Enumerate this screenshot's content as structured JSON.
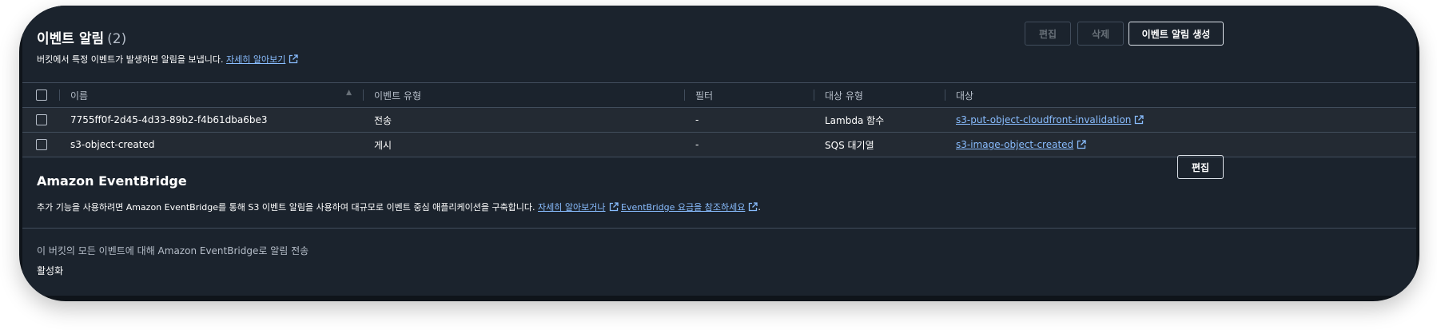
{
  "event_notifications": {
    "title": "이벤트 알림",
    "count": "(2)",
    "description": "버킷에서 특정 이벤트가 발생하면 알림을 보냅니다.",
    "learn_more": "자세히 알아보기",
    "buttons": {
      "edit": "편집",
      "delete": "삭제",
      "create": "이벤트 알림 생성"
    },
    "columns": {
      "name": "이름",
      "event_type": "이벤트 유형",
      "filter": "필터",
      "destination_type": "대상 유형",
      "destination": "대상"
    },
    "rows": [
      {
        "name": "7755ff0f-2d45-4d33-89b2-f4b61dba6be3",
        "event_type": "전송",
        "filter": "-",
        "destination_type": "Lambda 함수",
        "destination": "s3-put-object-cloudfront-invalidation"
      },
      {
        "name": "s3-object-created",
        "event_type": "게시",
        "filter": "-",
        "destination_type": "SQS 대기열",
        "destination": "s3-image-object-created"
      }
    ]
  },
  "eventbridge": {
    "title": "Amazon EventBridge",
    "description": "추가 기능을 사용하려면 Amazon EventBridge를 통해 S3 이벤트 알림을 사용하여 대규모로 이벤트 중심 애플리케이션을 구축합니다.",
    "learn_more": "자세히 알아보거나",
    "pricing": "EventBridge 요금을 참조하세요",
    "period": ".",
    "edit": "편집",
    "label": "이 버킷의 모든 이벤트에 대해 Amazon EventBridge로 알림 전송",
    "value": "활성화"
  },
  "colors": {
    "link": "#89bdff",
    "panel": "#1b232d",
    "row": "#232a33",
    "border": "#414d5c"
  },
  "icons": [
    "external-link-icon",
    "sort-ascending-icon",
    "checkbox"
  ]
}
